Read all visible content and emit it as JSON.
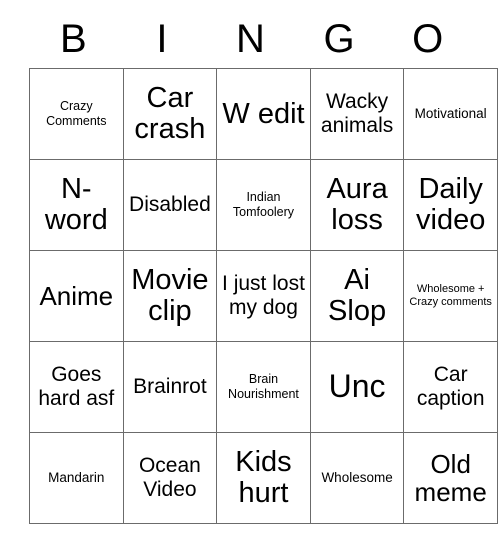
{
  "card": {
    "header_letters": [
      "B",
      "I",
      "N",
      "G",
      "O"
    ],
    "rows": [
      [
        {
          "text": "Crazy Comments",
          "size": "sm"
        },
        {
          "text": "Car crash",
          "size": "2xl"
        },
        {
          "text": "W edit",
          "size": "2xl"
        },
        {
          "text": "Wacky animals",
          "size": "lg"
        },
        {
          "text": "Motivational",
          "size": "md"
        }
      ],
      [
        {
          "text": "N-word",
          "size": "2xl"
        },
        {
          "text": "Disabled",
          "size": "lg"
        },
        {
          "text": "Indian Tomfoolery",
          "size": "sm"
        },
        {
          "text": "Aura loss",
          "size": "2xl"
        },
        {
          "text": "Daily video",
          "size": "2xl"
        }
      ],
      [
        {
          "text": "Anime",
          "size": "xl"
        },
        {
          "text": "Movie clip",
          "size": "2xl"
        },
        {
          "text": "I just lost my dog",
          "size": "lg"
        },
        {
          "text": "Ai Slop",
          "size": "2xl"
        },
        {
          "text": "Wholesome + Crazy comments",
          "size": "xs"
        }
      ],
      [
        {
          "text": "Goes hard asf",
          "size": "lg"
        },
        {
          "text": "Brainrot",
          "size": "lg"
        },
        {
          "text": "Brain Nourishment",
          "size": "sm"
        },
        {
          "text": "Unc",
          "size": "3xl"
        },
        {
          "text": "Car caption",
          "size": "lg"
        }
      ],
      [
        {
          "text": "Mandarin",
          "size": "md"
        },
        {
          "text": "Ocean Video",
          "size": "lg"
        },
        {
          "text": "Kids hurt",
          "size": "2xl"
        },
        {
          "text": "Wholesome",
          "size": "md"
        },
        {
          "text": "Old meme",
          "size": "xl"
        }
      ]
    ]
  },
  "colors": {
    "background": "#ffffff",
    "text": "#000000",
    "grid_border": "#6b6b6b"
  }
}
